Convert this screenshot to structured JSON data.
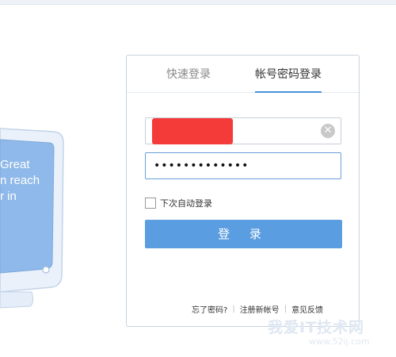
{
  "monitor": {
    "screen_lines": [
      "Great",
      "n reach",
      "r in"
    ]
  },
  "login": {
    "tabs": [
      {
        "label": "快速登录",
        "active": false
      },
      {
        "label": "帐号密码登录",
        "active": true
      }
    ],
    "password_value": "•••••••••••••",
    "remember_label": "下次自动登录",
    "login_button": "登 录",
    "footer": {
      "forgot": "忘了密码?",
      "register": "注册新帐号",
      "feedback": "意见反馈",
      "separator": "|"
    },
    "colors": {
      "accent": "#5a9de0",
      "redaction": "#f53a3a",
      "border": "#c9d3df"
    }
  },
  "watermark": {
    "title": "我爱IT技术网",
    "url": "www.52ij.com"
  }
}
